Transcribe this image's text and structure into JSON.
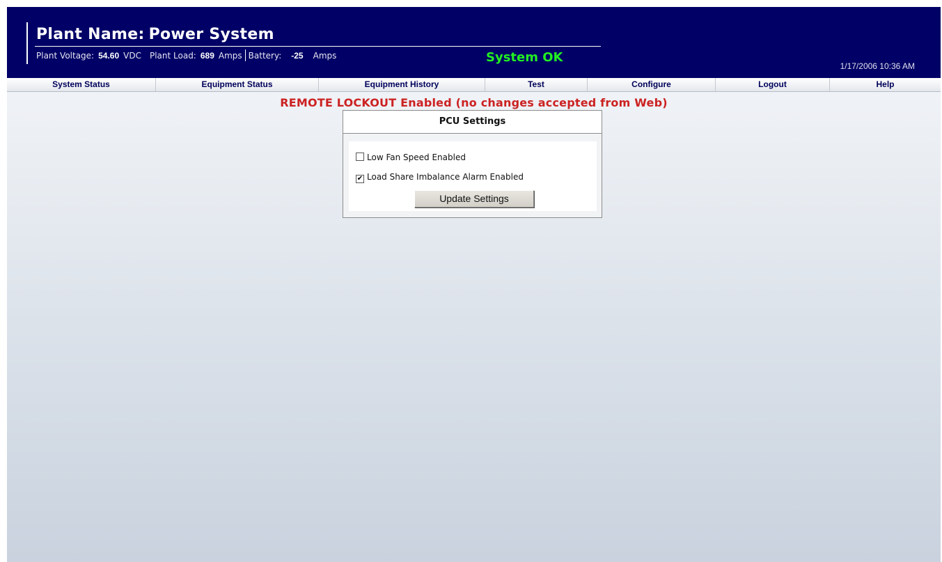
{
  "header": {
    "title_label": "Plant Name:",
    "title_value": "Power System",
    "plant_voltage_label": "Plant Voltage:",
    "plant_voltage_value": "54.60",
    "plant_voltage_unit": "VDC",
    "plant_load_label": "Plant Load:",
    "plant_load_value": "689",
    "plant_load_unit": "Amps",
    "battery_label": "Battery:",
    "battery_value": "-25",
    "battery_unit": "Amps",
    "system_status": "System OK",
    "datetime": "1/17/2006 10:36 AM"
  },
  "nav": {
    "items": [
      "System Status",
      "Equipment Status",
      "Equipment History",
      "Test",
      "Configure",
      "Logout",
      "Help"
    ]
  },
  "main": {
    "lockout_message": "REMOTE LOCKOUT Enabled (no changes accepted from Web)",
    "panel_title": "PCU Settings",
    "options": [
      {
        "label": "Low Fan Speed Enabled",
        "checked": false
      },
      {
        "label": "Load Share Imbalance Alarm Enabled",
        "checked": true
      }
    ],
    "update_button": "Update Settings"
  },
  "colors": {
    "header_bg": "#000066",
    "status_ok": "#22ee22",
    "lockout_text": "#cc2222"
  }
}
